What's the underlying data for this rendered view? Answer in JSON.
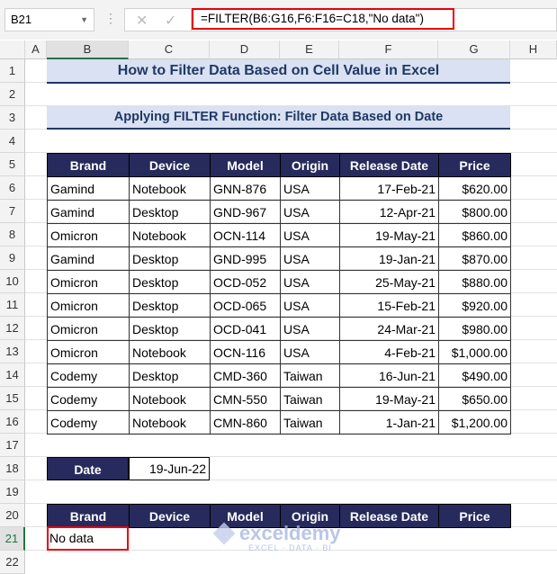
{
  "name_box": "B21",
  "formula": "=FILTER(B6:G16,F6:F16=C18,\"No data\")",
  "columns": [
    "A",
    "B",
    "C",
    "D",
    "E",
    "F",
    "G",
    "H"
  ],
  "rows": [
    "1",
    "2",
    "3",
    "4",
    "5",
    "6",
    "7",
    "8",
    "9",
    "10",
    "11",
    "12",
    "13",
    "14",
    "15",
    "16",
    "17",
    "18",
    "19",
    "20",
    "21",
    "22"
  ],
  "title": "How to Filter Data Based on Cell Value in Excel",
  "subtitle": "Applying FILTER Function: Filter Data Based on Date",
  "headers": [
    "Brand",
    "Device",
    "Model",
    "Origin",
    "Release Date",
    "Price"
  ],
  "data": [
    [
      "Gamind",
      "Notebook",
      "GNN-876",
      "USA",
      "17-Feb-21",
      "$620.00"
    ],
    [
      "Gamind",
      "Desktop",
      "GND-967",
      "USA",
      "12-Apr-21",
      "$800.00"
    ],
    [
      "Omicron",
      "Notebook",
      "OCN-114",
      "USA",
      "19-May-21",
      "$860.00"
    ],
    [
      "Gamind",
      "Desktop",
      "GND-995",
      "USA",
      "19-Jan-21",
      "$870.00"
    ],
    [
      "Omicron",
      "Desktop",
      "OCD-052",
      "USA",
      "25-May-21",
      "$880.00"
    ],
    [
      "Omicron",
      "Desktop",
      "OCD-065",
      "USA",
      "15-Feb-21",
      "$920.00"
    ],
    [
      "Omicron",
      "Desktop",
      "OCD-041",
      "USA",
      "24-Mar-21",
      "$980.00"
    ],
    [
      "Omicron",
      "Notebook",
      "OCN-116",
      "USA",
      "4-Feb-21",
      "$1,000.00"
    ],
    [
      "Codemy",
      "Desktop",
      "CMD-360",
      "Taiwan",
      "16-Jun-21",
      "$490.00"
    ],
    [
      "Codemy",
      "Notebook",
      "CMN-550",
      "Taiwan",
      "19-May-21",
      "$650.00"
    ],
    [
      "Codemy",
      "Notebook",
      "CMN-860",
      "Taiwan",
      "1-Jan-21",
      "$1,200.00"
    ]
  ],
  "date_label": "Date",
  "date_value": "19-Jun-22",
  "result": "No data",
  "watermark": {
    "name": "exceldemy",
    "tagline": "EXCEL · DATA · BI"
  }
}
